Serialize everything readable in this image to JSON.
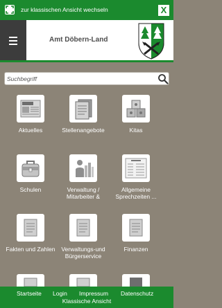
{
  "topbar": {
    "switch_label": "zur klassischen Ansicht wechseln",
    "close_label": "X"
  },
  "header": {
    "brand": "Amt Döbern-Land"
  },
  "search": {
    "placeholder": "Suchbegriff"
  },
  "tiles": [
    {
      "label": "Aktuelles",
      "icon": "newspaper-icon"
    },
    {
      "label": "Stellenangebote",
      "icon": "documents-icon"
    },
    {
      "label": "Kitas",
      "icon": "toy-blocks-icon"
    },
    {
      "label": "Schulen",
      "icon": "school-bag-icon"
    },
    {
      "label": "Verwaltung / Mitarbeiter &",
      "icon": "staff-icon"
    },
    {
      "label": "Allgemeine Sprechzeiten ...",
      "icon": "opening-hours-icon"
    },
    {
      "label": "Fakten und Zahlen",
      "icon": "document-icon"
    },
    {
      "label": "Verwaltungs-und Bürgerservice",
      "icon": "document-icon"
    },
    {
      "label": "Finanzen",
      "icon": "document-icon"
    }
  ],
  "footer": {
    "links": [
      "Startseite",
      "Login",
      "Impressum",
      "Datenschutz"
    ],
    "classic": "Klassische Ansicht"
  },
  "colors": {
    "brand_green": "#1b8a2e",
    "background": "#8c8477",
    "menu_dark": "#3c3c3c"
  }
}
